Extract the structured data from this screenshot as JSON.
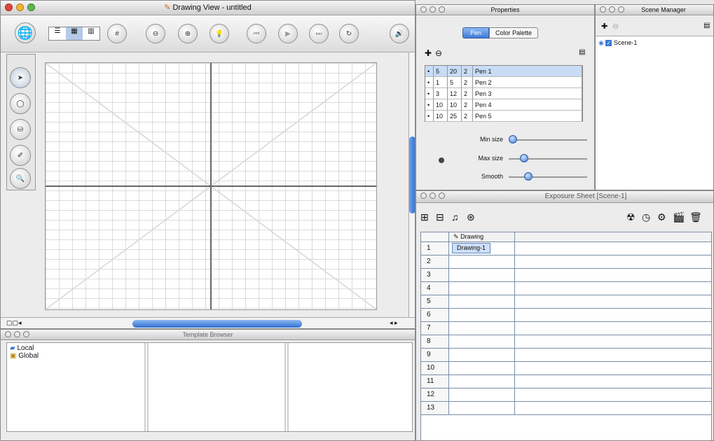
{
  "drawing_view": {
    "title": "Drawing View - untitled"
  },
  "properties": {
    "title": "Properties",
    "tabs": [
      "Pen",
      "Color Palette"
    ],
    "pens": [
      {
        "col1": "5",
        "col2": "20",
        "col3": "2",
        "name": "Pen 1",
        "selected": true
      },
      {
        "col1": "1",
        "col2": "5",
        "col3": "2",
        "name": "Pen 2",
        "selected": false
      },
      {
        "col1": "3",
        "col2": "12",
        "col3": "2",
        "name": "Pen 3",
        "selected": false
      },
      {
        "col1": "10",
        "col2": "10",
        "col3": "2",
        "name": "Pen 4",
        "selected": false
      },
      {
        "col1": "10",
        "col2": "25",
        "col3": "2",
        "name": "Pen 5",
        "selected": false
      }
    ],
    "sliders": [
      {
        "label": "Min size",
        "value": 0.05
      },
      {
        "label": "Max size",
        "value": 0.2
      },
      {
        "label": "Smooth",
        "value": 0.25
      }
    ]
  },
  "scene_manager": {
    "title": "Scene Manager",
    "scene": "Scene-1"
  },
  "exposure_sheet": {
    "title": "Exposure Sheet [Scene-1]",
    "column_header": "Drawing",
    "cell": "Drawing-1",
    "rows": [
      "1",
      "2",
      "3",
      "4",
      "5",
      "6",
      "7",
      "8",
      "9",
      "10",
      "11",
      "12",
      "13"
    ]
  },
  "template_browser": {
    "title": "Template Browser",
    "items": [
      "Local",
      "Global"
    ]
  },
  "colors": {
    "accent": "#3c79d8",
    "selection": "#c8dcf5"
  }
}
